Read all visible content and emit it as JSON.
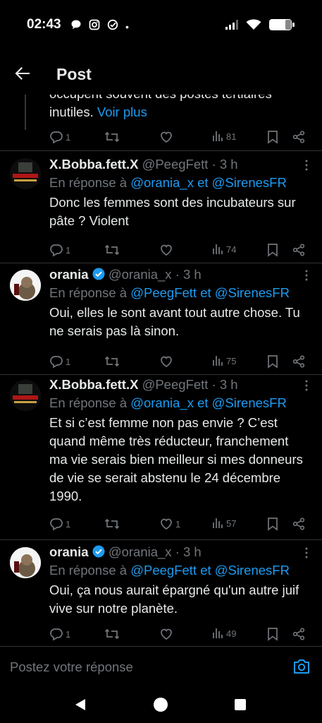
{
  "status_bar": {
    "time": "02:43",
    "dot": "•"
  },
  "header": {
    "title": "Post"
  },
  "top_tweet": {
    "cut_text": "occupent souvent des postes tertiaires",
    "text": "inutiles.",
    "more_link": "Voir plus",
    "replies": "1",
    "views": "81"
  },
  "tweets": [
    {
      "name": "X.Bobba.fett.X",
      "handle": "@PeegFett · 3 h",
      "reply_prefix": "En réponse à",
      "reply_mentions": "@orania_x et @SirenesFR",
      "text": "Donc les femmes sont des incubateurs sur pâte ? Violent",
      "replies": "1",
      "likes": "",
      "views": "74"
    },
    {
      "name": "orania",
      "handle": "@orania_x · 3 h",
      "reply_prefix": "En réponse à",
      "reply_mentions": "@PeegFett et @SirenesFR",
      "text": "Oui, elles le sont avant tout autre chose. Tu ne serais pas là sinon.",
      "replies": "1",
      "likes": "",
      "views": "75"
    },
    {
      "name": "X.Bobba.fett.X",
      "handle": "@PeegFett · 3 h",
      "reply_prefix": "En réponse à",
      "reply_mentions": "@orania_x et @SirenesFR",
      "text": "Et si c’est femme non pas envie ? C’est quand même très réducteur, franchement ma vie serais bien meilleur si mes donneurs de vie se serait abstenu le 24 décembre 1990.",
      "replies": "1",
      "likes": "1",
      "views": "57"
    },
    {
      "name": "orania",
      "handle": "@orania_x · 3 h",
      "reply_prefix": "En réponse à",
      "reply_mentions": "@PeegFett et @SirenesFR",
      "text": "Oui, ça nous aurait épargné qu'un autre juif vive sur notre planète.",
      "replies": "1",
      "likes": "",
      "views": "49"
    }
  ],
  "reply_bar": {
    "placeholder": "Postez votre réponse"
  },
  "colors": {
    "background": "#000000",
    "text": "#e7e9ea",
    "muted": "#71767b",
    "link": "#1d9bf0",
    "verified": "#1d9bf0"
  }
}
